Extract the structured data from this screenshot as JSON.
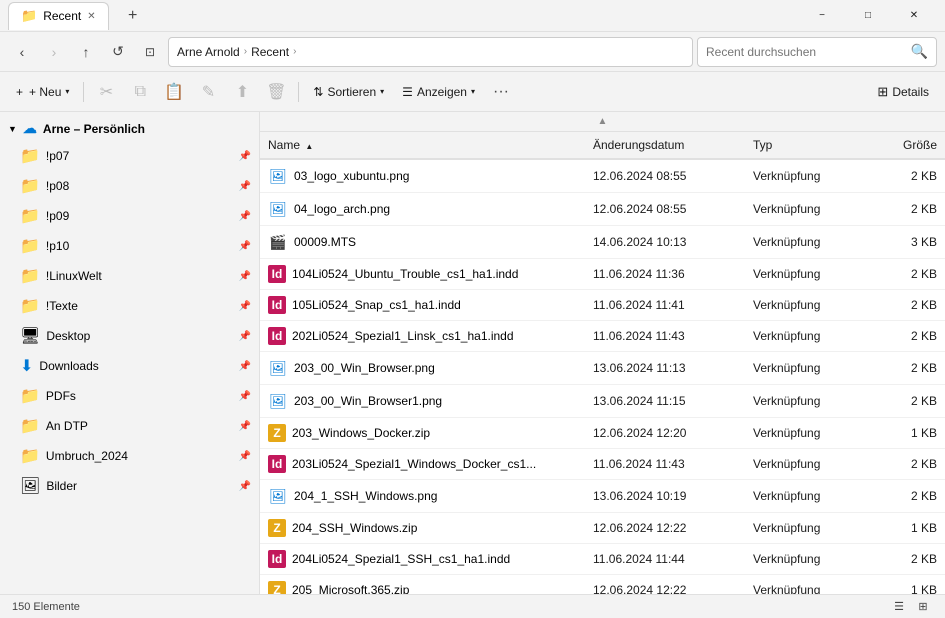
{
  "titlebar": {
    "tab_label": "Recent",
    "tab_icon": "folder-icon",
    "new_tab_tooltip": "Neues Tab",
    "min_label": "−",
    "max_label": "□",
    "close_label": "✕"
  },
  "addressbar": {
    "back_disabled": false,
    "forward_disabled": true,
    "up_label": "↑",
    "refresh_label": "↺",
    "location_label": "⊡",
    "breadcrumb": [
      {
        "label": "Arne Arnold",
        "id": "arne-arnold"
      },
      {
        "label": ">",
        "sep": true
      },
      {
        "label": "Recent",
        "id": "recent"
      },
      {
        "label": ">",
        "sep": true
      }
    ],
    "search_placeholder": "Recent durchsuchen",
    "search_icon": "🔍"
  },
  "toolbar": {
    "neu_label": "+ Neu",
    "cut_icon": "✂",
    "copy_icon": "⧉",
    "paste_icon": "📋",
    "rename_icon": "✎",
    "share_icon": "⬆",
    "delete_icon": "🗑",
    "sort_label": "Sortieren",
    "view_label": "Anzeigen",
    "more_icon": "···",
    "details_label": "Details"
  },
  "sidebar": {
    "section_label": "Arne – Persönlich",
    "cloud_icon": "☁",
    "items": [
      {
        "label": "!p07",
        "icon": "📁",
        "pinned": true
      },
      {
        "label": "!p08",
        "icon": "📁",
        "pinned": true
      },
      {
        "label": "!p09",
        "icon": "📁",
        "pinned": true
      },
      {
        "label": "!p10",
        "icon": "📁",
        "pinned": true
      },
      {
        "label": "!LinuxWelt",
        "icon": "📁",
        "pinned": true
      },
      {
        "label": "!Texte",
        "icon": "📁",
        "pinned": true
      },
      {
        "label": "Desktop",
        "icon": "🖥",
        "pinned": true
      },
      {
        "label": "Downloads",
        "icon": "⬇",
        "pinned": true
      },
      {
        "label": "PDFs",
        "icon": "📁",
        "pinned": true
      },
      {
        "label": "An DTP",
        "icon": "📁",
        "pinned": true
      },
      {
        "label": "Umbruch_2024",
        "icon": "📁",
        "pinned": true
      },
      {
        "label": "Bilder",
        "icon": "🖼",
        "pinned": true
      }
    ]
  },
  "filelist": {
    "columns": [
      {
        "label": "Name",
        "sort": "asc",
        "id": "name"
      },
      {
        "label": "Änderungsdatum",
        "id": "date"
      },
      {
        "label": "Typ",
        "id": "type"
      },
      {
        "label": "Größe",
        "id": "size"
      }
    ],
    "files": [
      {
        "name": "03_logo_xubuntu.png",
        "icon": "png",
        "date": "12.06.2024 08:55",
        "type": "Verknüpfung",
        "size": "2 KB"
      },
      {
        "name": "04_logo_arch.png",
        "icon": "png",
        "date": "12.06.2024 08:55",
        "type": "Verknüpfung",
        "size": "2 KB"
      },
      {
        "name": "00009.MTS",
        "icon": "mts",
        "date": "14.06.2024 10:13",
        "type": "Verknüpfung",
        "size": "3 KB"
      },
      {
        "name": "104Li0524_Ubuntu_Trouble_cs1_ha1.indd",
        "icon": "indd",
        "date": "11.06.2024 11:36",
        "type": "Verknüpfung",
        "size": "2 KB"
      },
      {
        "name": "105Li0524_Snap_cs1_ha1.indd",
        "icon": "indd",
        "date": "11.06.2024 11:41",
        "type": "Verknüpfung",
        "size": "2 KB"
      },
      {
        "name": "202Li0524_Spezial1_Linsk_cs1_ha1.indd",
        "icon": "indd",
        "date": "11.06.2024 11:43",
        "type": "Verknüpfung",
        "size": "2 KB"
      },
      {
        "name": "203_00_Win_Browser.png",
        "icon": "png",
        "date": "13.06.2024 11:13",
        "type": "Verknüpfung",
        "size": "2 KB"
      },
      {
        "name": "203_00_Win_Browser1.png",
        "icon": "png",
        "date": "13.06.2024 11:15",
        "type": "Verknüpfung",
        "size": "2 KB"
      },
      {
        "name": "203_Windows_Docker.zip",
        "icon": "zip",
        "date": "12.06.2024 12:20",
        "type": "Verknüpfung",
        "size": "1 KB"
      },
      {
        "name": "203Li0524_Spezial1_Windows_Docker_cs1...",
        "icon": "indd",
        "date": "11.06.2024 11:43",
        "type": "Verknüpfung",
        "size": "2 KB"
      },
      {
        "name": "204_1_SSH_Windows.png",
        "icon": "png",
        "date": "13.06.2024 10:19",
        "type": "Verknüpfung",
        "size": "2 KB"
      },
      {
        "name": "204_SSH_Windows.zip",
        "icon": "zip",
        "date": "12.06.2024 12:22",
        "type": "Verknüpfung",
        "size": "1 KB"
      },
      {
        "name": "204Li0524_Spezial1_SSH_cs1_ha1.indd",
        "icon": "indd",
        "date": "11.06.2024 11:44",
        "type": "Verknüpfung",
        "size": "2 KB"
      },
      {
        "name": "205_Microsoft.365.zip",
        "icon": "zip",
        "date": "12.06.2024 12:22",
        "type": "Verknüpfung",
        "size": "1 KB"
      }
    ]
  },
  "statusbar": {
    "count_label": "150 Elemente",
    "view1_icon": "☰",
    "view2_icon": "⊞"
  }
}
